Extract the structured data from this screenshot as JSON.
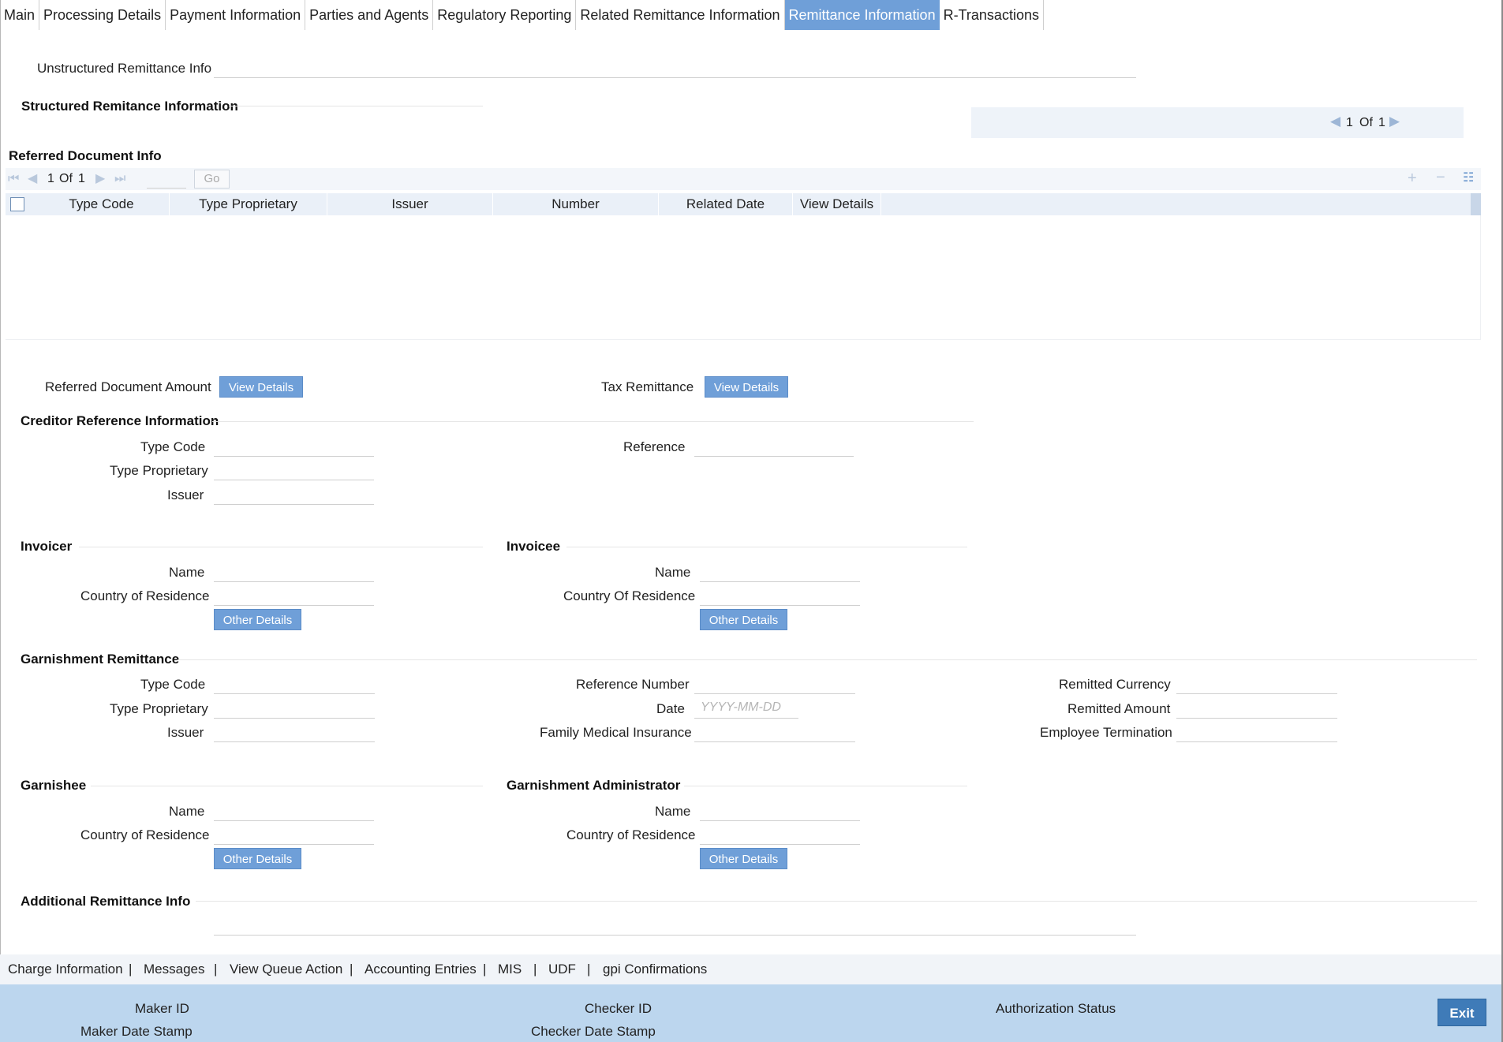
{
  "tabs": [
    "Main",
    "Processing Details",
    "Payment Information",
    "Parties and Agents",
    "Regulatory Reporting",
    "Related Remittance Information",
    "Remittance Information",
    "R-Transactions"
  ],
  "active_tab": "Remittance Information",
  "unstructured": {
    "label": "Unstructured Remittance Info",
    "value": ""
  },
  "structured": {
    "title": "Structured Remitance Information",
    "pager": {
      "current": "1",
      "of": "Of",
      "total": "1"
    }
  },
  "referred_doc": {
    "title": "Referred Document Info",
    "pager": {
      "current": "1",
      "of": "Of",
      "total": "1",
      "go": "Go"
    },
    "columns": [
      "Type Code",
      "Type Proprietary",
      "Issuer",
      "Number",
      "Related Date",
      "View Details"
    ],
    "rows": []
  },
  "buttons": {
    "referred_doc_amount_label": "Referred Document Amount",
    "tax_remittance_label": "Tax Remittance",
    "view_details": "View Details",
    "other_details": "Other Details"
  },
  "creditor_ref": {
    "title": "Creditor Reference Information",
    "type_code": "Type Code",
    "type_proprietary": "Type Proprietary",
    "issuer": "Issuer",
    "reference": "Reference"
  },
  "invoicer": {
    "title": "Invoicer",
    "name": "Name",
    "country": "Country of Residence"
  },
  "invoicee": {
    "title": "Invoicee",
    "name": "Name",
    "country": "Country Of Residence"
  },
  "garnishment": {
    "title": "Garnishment Remittance",
    "type_code": "Type Code",
    "type_proprietary": "Type Proprietary",
    "issuer": "Issuer",
    "reference_number": "Reference Number",
    "date": "Date",
    "date_placeholder": "YYYY-MM-DD",
    "family_medical": "Family Medical Insurance",
    "remitted_currency": "Remitted Currency",
    "remitted_amount": "Remitted Amount",
    "employee_termination": "Employee Termination"
  },
  "garnishee": {
    "title": "Garnishee",
    "name": "Name",
    "country": "Country of Residence"
  },
  "garnishment_admin": {
    "title": "Garnishment Administrator",
    "name": "Name",
    "country": "Country of Residence"
  },
  "additional": {
    "title": "Additional Remittance Info"
  },
  "bottom_links": [
    "Charge Information",
    "Messages",
    "View Queue Action",
    "Accounting Entries",
    "MIS",
    "UDF",
    "gpi Confirmations"
  ],
  "footer": {
    "maker_id": "Maker ID",
    "maker_date": "Maker Date Stamp",
    "checker_id": "Checker ID",
    "checker_date": "Checker Date Stamp",
    "auth_status": "Authorization Status",
    "exit": "Exit"
  },
  "colors": {
    "accent": "#6f9fd8",
    "footer": "#bcd6ee",
    "exit": "#3f7bb8"
  }
}
